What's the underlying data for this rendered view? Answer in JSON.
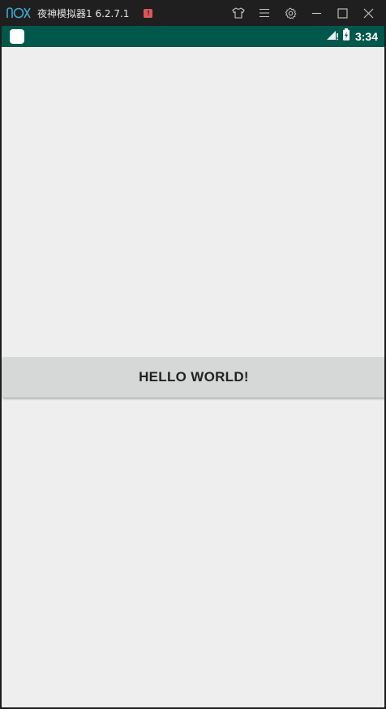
{
  "titlebar": {
    "app_name": "夜神模拟器1 6.2.7.1",
    "alert_badge": "!",
    "logo_icon": "nox-logo-icon",
    "controls": [
      "shirt-icon",
      "menu-icon",
      "gear-icon",
      "minimize-icon",
      "maximize-icon",
      "close-icon"
    ]
  },
  "statusbar": {
    "time": "3:34",
    "icons": [
      "signal-icon",
      "battery-icon"
    ]
  },
  "main": {
    "button_label": "HELLO WORLD!"
  },
  "colors": {
    "titlebar_bg": "#1f1f1f",
    "statusbar_bg": "#00574b",
    "screen_bg": "#eeeeee",
    "button_bg": "#d6d7d7",
    "alert": "#e05757",
    "logo": "#3fa9d6"
  }
}
